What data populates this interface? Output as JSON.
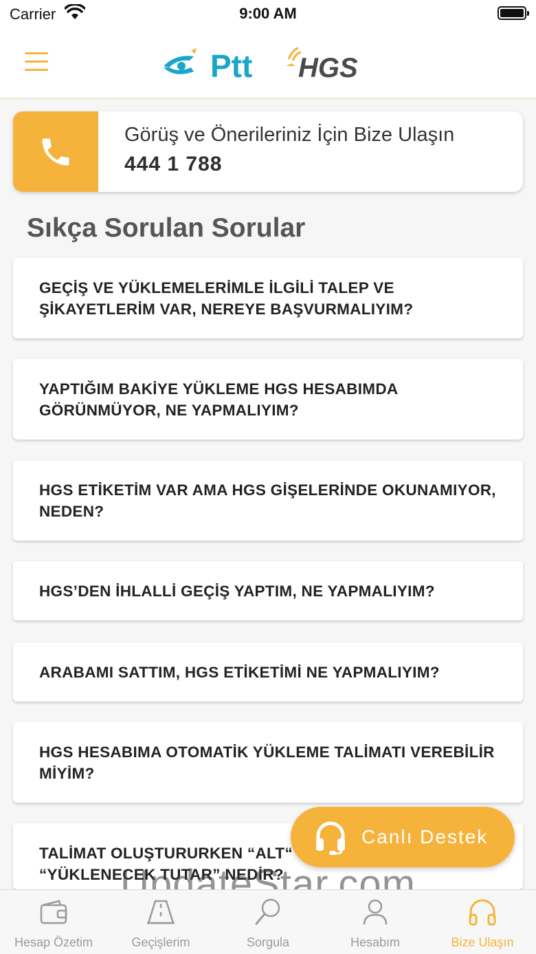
{
  "status_bar": {
    "carrier": "Carrier",
    "time": "9:00 AM"
  },
  "header": {
    "logo_ptt": "Ptt",
    "logo_hgs": "HGS"
  },
  "contact": {
    "title": "Görüş ve Önerileriniz İçin Bize Ulaşın",
    "phone": "444 1 788"
  },
  "faq": {
    "heading": "Sıkça Sorulan Sorular",
    "items": [
      "GEÇİŞ VE YÜKLEMELERİMLE İLGİLİ TALEP VE ŞİKAYETLERİM VAR, NEREYE BAŞVURMALIYIM?",
      "YAPTIĞIM BAKİYE YÜKLEME HGS HESABIMDA GÖRÜNMÜYOR, NE YAPMALIYIM?",
      "HGS ETİKETİM VAR AMA HGS GİŞELERİNDE OKUNAMIYOR, NEDEN?",
      "HGS’DEN İHLALLİ GEÇİŞ YAPTIM, NE YAPMALIYIM?",
      "ARABAMI SATTIM, HGS ETİKETİMİ NE YAPMALIYIM?",
      "HGS HESABIMA OTOMATİK YÜKLEME TALİMATI VEREBİLİR MİYİM?",
      "TALİMAT OLUŞTURURKEN “ALT“ “YÜKLENECEK TUTAR” NEDİR?"
    ]
  },
  "live_support": {
    "label": "Canlı Destek"
  },
  "watermark": "UpdateStar.com",
  "tabs": [
    {
      "label": "Hesap Özetim",
      "icon": "wallet-icon",
      "active": false
    },
    {
      "label": "Geçişlerim",
      "icon": "road-icon",
      "active": false
    },
    {
      "label": "Sorgula",
      "icon": "search-icon",
      "active": false
    },
    {
      "label": "Hesabım",
      "icon": "user-icon",
      "active": false
    },
    {
      "label": "Bize Ulaşın",
      "icon": "headphones-icon",
      "active": true
    }
  ],
  "colors": {
    "accent": "#f6b33c",
    "ptt_blue": "#1aa6c8",
    "hgs_dark": "#4a4a4a"
  }
}
